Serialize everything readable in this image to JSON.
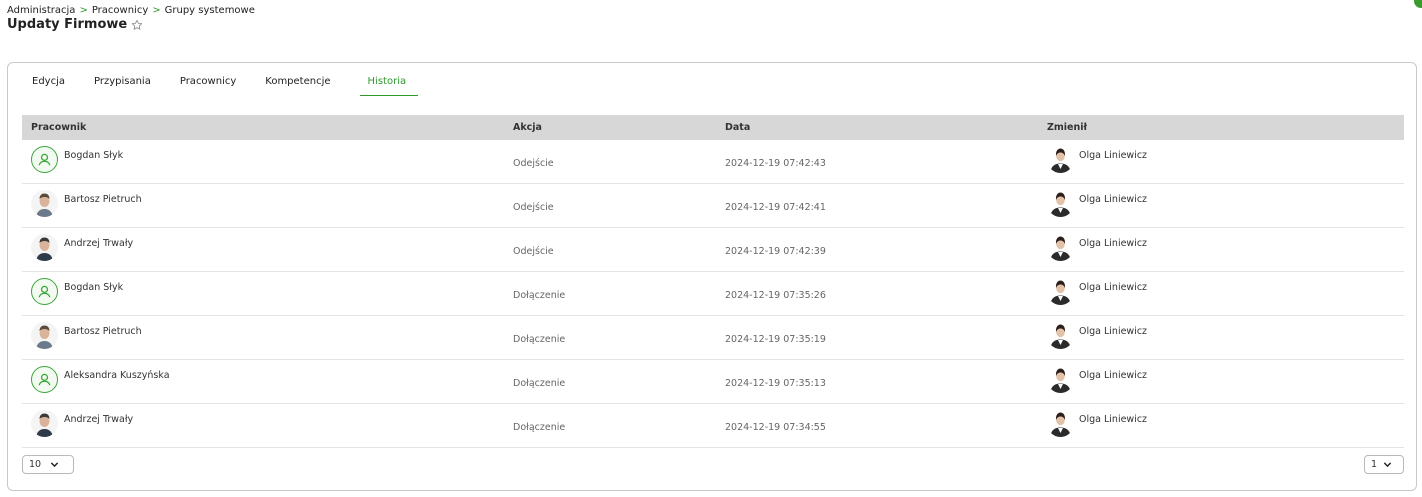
{
  "breadcrumb": {
    "items": [
      "Administracja",
      "Pracownicy",
      "Grupy systemowe"
    ],
    "separator": ">"
  },
  "page": {
    "title": "Updaty Firmowe"
  },
  "tabs": [
    {
      "label": "Edycja",
      "active": false
    },
    {
      "label": "Przypisania",
      "active": false
    },
    {
      "label": "Pracownicy",
      "active": false
    },
    {
      "label": "Kompetencje",
      "active": false
    },
    {
      "label": "Historia",
      "active": true
    }
  ],
  "table": {
    "headers": [
      "Pracownik",
      "Akcja",
      "Data",
      "Zmienił"
    ],
    "rows": [
      {
        "employee": "Bogdan Słyk",
        "avatar": "placeholder-user-icon",
        "action": "Odejście",
        "date": "2024-12-19 07:42:43",
        "changed_by": "Olga Liniewicz"
      },
      {
        "employee": "Bartosz Pietruch",
        "avatar": "photo",
        "action": "Odejście",
        "date": "2024-12-19 07:42:41",
        "changed_by": "Olga Liniewicz"
      },
      {
        "employee": "Andrzej Trwały",
        "avatar": "photo",
        "action": "Odejście",
        "date": "2024-12-19 07:42:39",
        "changed_by": "Olga Liniewicz"
      },
      {
        "employee": "Bogdan Słyk",
        "avatar": "placeholder-user-icon",
        "action": "Dołączenie",
        "date": "2024-12-19 07:35:26",
        "changed_by": "Olga Liniewicz"
      },
      {
        "employee": "Bartosz Pietruch",
        "avatar": "photo",
        "action": "Dołączenie",
        "date": "2024-12-19 07:35:19",
        "changed_by": "Olga Liniewicz"
      },
      {
        "employee": "Aleksandra Kuszyńska",
        "avatar": "placeholder-user-icon",
        "action": "Dołączenie",
        "date": "2024-12-19 07:35:13",
        "changed_by": "Olga Liniewicz"
      },
      {
        "employee": "Andrzej Trwały",
        "avatar": "photo",
        "action": "Dołączenie",
        "date": "2024-12-19 07:34:55",
        "changed_by": "Olga Liniewicz"
      }
    ]
  },
  "pagination": {
    "page_size": "10",
    "page": "1"
  },
  "colors": {
    "accent": "#2e9a2e",
    "header_bg": "#d7d7d7",
    "border": "#c9c9c9"
  }
}
